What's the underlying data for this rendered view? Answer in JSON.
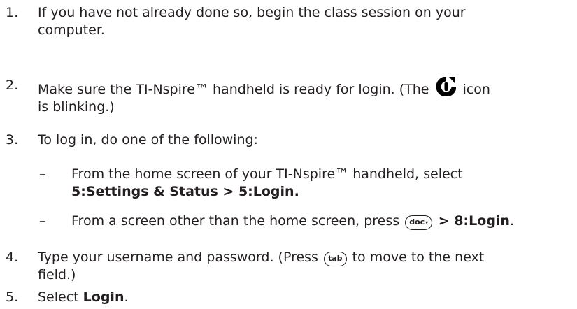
{
  "steps": [
    {
      "number": "1.",
      "line1": "If you have not already done so, begin the class session on your",
      "line2": "computer."
    },
    {
      "number": "2.",
      "line1_before_icon": "Make sure the TI-Nspire™ handheld is ready for login. (The",
      "line1_after_icon": "icon",
      "line2": "is blinking.)",
      "icon": "login-icon"
    },
    {
      "number": "3.",
      "line1": "To log in, do one of the following:",
      "options": [
        {
          "dash": "–",
          "line1": "From the home screen of your TI-Nspire™ handheld, select",
          "line2_bold": "5:Settings & Status > 5:Login."
        },
        {
          "dash": "–",
          "text_before_key": "From a screen other than the home screen, press",
          "key": "doc",
          "text_after_key_bold": "> 8:Login",
          "text_end": "."
        }
      ]
    },
    {
      "number": "4.",
      "line1_before_key": "Type your username and password. (Press",
      "key": "tab",
      "line1_after_key": "to move to the next",
      "line2": "field.)"
    },
    {
      "number": "5.",
      "text_before_bold": "Select",
      "bold": "Login",
      "text_end": "."
    }
  ]
}
